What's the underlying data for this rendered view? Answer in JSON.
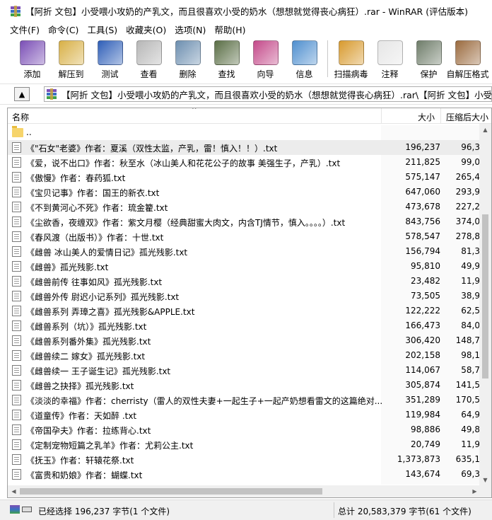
{
  "window": {
    "title": "【阿折 文包】小受喂小攻奶的产乳文，而且很喜欢小受的奶水（想想就觉得丧心病狂）.rar - WinRAR (评估版本)"
  },
  "menu": [
    "文件(F)",
    "命令(C)",
    "工具(S)",
    "收藏夹(O)",
    "选项(N)",
    "帮助(H)"
  ],
  "toolbar": [
    {
      "label": "添加",
      "icon": "add-archive-icon",
      "color": "#7b4fb6"
    },
    {
      "label": "解压到",
      "icon": "extract-to-icon",
      "color": "#d8b046"
    },
    {
      "label": "测试",
      "icon": "test-icon",
      "color": "#2f5fb8"
    },
    {
      "label": "查看",
      "icon": "view-glasses-icon",
      "color": "#b7b7b7"
    },
    {
      "label": "删除",
      "icon": "delete-recycle-icon",
      "color": "#6d8fb0"
    },
    {
      "label": "查找",
      "icon": "find-binoculars-icon",
      "color": "#5a6e45"
    },
    {
      "label": "向导",
      "icon": "wizard-icon",
      "color": "#c44a8a"
    },
    {
      "label": "信息",
      "icon": "info-icon",
      "color": "#4f8fcf"
    },
    {
      "label": "扫描病毒",
      "icon": "virus-scan-icon",
      "color": "#d89a2e"
    },
    {
      "label": "注释",
      "icon": "comment-icon",
      "color": "#e6e6e6"
    },
    {
      "label": "保护",
      "icon": "protect-shield-icon",
      "color": "#6f7d6a"
    },
    {
      "label": "自解压格式",
      "icon": "sfx-icon",
      "color": "#9b6b3f"
    }
  ],
  "address": {
    "path": "【阿折 文包】小受喂小攻奶的产乳文，而且很喜欢小受的奶水（想想就觉得丧心病狂）.rar\\【阿折 文包】小受喂小攻"
  },
  "columns": {
    "name": "名称",
    "size": "大小",
    "packed": "压缩后大小"
  },
  "files": [
    {
      "name": "..",
      "size": "",
      "packed": "",
      "folder": true
    },
    {
      "name": "《\"石女\"老婆》作者：夏溪（双性太监，产乳，雷！慎入！！）.txt",
      "size": "196,237",
      "packed": "96,3"
    },
    {
      "name": "《爱，说不出口》作者：秋至水（冰山美人和花花公子的故事 美强生子，产乳）.txt",
      "size": "211,825",
      "packed": "99,0"
    },
    {
      "name": "《傲慢》作者：春药狐.txt",
      "size": "575,147",
      "packed": "265,4"
    },
    {
      "name": "《宝贝记事》作者：国王的新衣.txt",
      "size": "647,060",
      "packed": "293,9"
    },
    {
      "name": "《不到黄河心不死》作者：琉金籊.txt",
      "size": "473,678",
      "packed": "227,2"
    },
    {
      "name": "《尘欲香，夜缠双》作者：紫文月樱（经典甜蜜大肉文，内含TJ情节，慎入。。。。）.txt",
      "size": "843,756",
      "packed": "374,0"
    },
    {
      "name": "《春风渡（出版书）》作者：十世.txt",
      "size": "578,547",
      "packed": "278,8"
    },
    {
      "name": "《雌兽 冰山美人的爱情日记》孤光残影.txt",
      "size": "156,794",
      "packed": "81,3"
    },
    {
      "name": "《雌兽》孤光残影.txt",
      "size": "95,810",
      "packed": "49,9"
    },
    {
      "name": "《雌兽前传 往事如风》孤光残影.txt",
      "size": "23,482",
      "packed": "11,9"
    },
    {
      "name": "《雌兽外传 尉迟小记系列》孤光残影.txt",
      "size": "73,505",
      "packed": "38,9"
    },
    {
      "name": "《雌兽系列 弄璋之喜》孤光残影&APPLE.txt",
      "size": "122,222",
      "packed": "62,5"
    },
    {
      "name": "《雌兽系列（坑）》孤光残影.txt",
      "size": "166,473",
      "packed": "84,0"
    },
    {
      "name": "《雌兽系列番外集》孤光残影.txt",
      "size": "306,420",
      "packed": "148,7"
    },
    {
      "name": "《雌兽续二 嫁女》孤光残影.txt",
      "size": "202,158",
      "packed": "98,1"
    },
    {
      "name": "《雌兽续一 王子诞生记》孤光残影.txt",
      "size": "114,067",
      "packed": "58,7"
    },
    {
      "name": "《雌兽之抉择》孤光残影.txt",
      "size": "305,874",
      "packed": "141,5"
    },
    {
      "name": "《淡淡的幸福》作者：cherristy（雷人的双性夫妻+一起生子+一起产奶想看雷文的这篇绝对...",
      "size": "351,289",
      "packed": "170,5"
    },
    {
      "name": "《道童传》作者：天如醉 .txt",
      "size": "119,984",
      "packed": "64,9"
    },
    {
      "name": "《帝国孕夫》作者：拉练背心.txt",
      "size": "98,886",
      "packed": "49,8"
    },
    {
      "name": "《定制宠物短篇之乳羊》作者：尤莉公主.txt",
      "size": "20,749",
      "packed": "11,9"
    },
    {
      "name": "《抚玉》作者：轩辕花祭.txt",
      "size": "1,373,873",
      "packed": "635,1"
    },
    {
      "name": "《富贵和奶娘》作者：蝴蝶.txt",
      "size": "143,674",
      "packed": "69,3"
    }
  ],
  "status": {
    "left": "已经选择 196,237 字节(1 个文件)",
    "right": "总计 20,583,379 字节(61 个文件)"
  }
}
